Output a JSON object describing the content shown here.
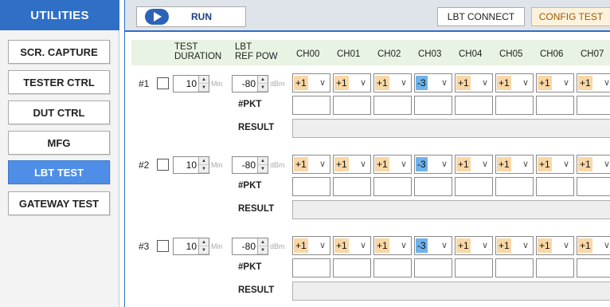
{
  "sidebar": {
    "title": "UTILITIES",
    "items": [
      {
        "label": "SCR. CAPTURE",
        "active": false
      },
      {
        "label": "TESTER CTRL",
        "active": false
      },
      {
        "label": "DUT CTRL",
        "active": false
      },
      {
        "label": "MFG",
        "active": false
      },
      {
        "label": "LBT TEST",
        "active": true
      },
      {
        "label": "GATEWAY TEST",
        "active": false
      }
    ]
  },
  "toolbar": {
    "run_label": "RUN",
    "lbt_connect_label": "LBT CONNECT",
    "config_test_label": "CONFIG TEST"
  },
  "table": {
    "test_duration_header": [
      "TEST",
      "DURATION"
    ],
    "lbt_ref_pow_header": [
      "LBT",
      "REF POW"
    ],
    "channels": [
      "CH00",
      "CH01",
      "CH02",
      "CH03",
      "CH04",
      "CH05",
      "CH06",
      "CH07"
    ],
    "pkt_label": "#PKT",
    "result_label": "RESULT",
    "duration_unit": "Min",
    "power_unit": "dBm"
  },
  "groups": [
    {
      "label": "#1",
      "duration": "10",
      "ref_pow": "-80",
      "channel_values": [
        "+1",
        "+1",
        "+1",
        "-3",
        "+1",
        "+1",
        "+1",
        "+1"
      ]
    },
    {
      "label": "#2",
      "duration": "10",
      "ref_pow": "-80",
      "channel_values": [
        "+1",
        "+1",
        "+1",
        "-3",
        "+1",
        "+1",
        "+1",
        "+1"
      ]
    },
    {
      "label": "#3",
      "duration": "10",
      "ref_pow": "-80",
      "channel_values": [
        "+1",
        "+1",
        "+1",
        "-3",
        "+1",
        "+1",
        "+1",
        "+1"
      ]
    }
  ],
  "colors": {
    "accent": "#2f6fc6",
    "active_item": "#4f8ee6",
    "dropdown_default_bg": "#f9d7a6",
    "dropdown_highlight_bg": "#6fb2ea",
    "header_strip_bg": "#e8f3e3"
  },
  "icons": {
    "run": "play-icon",
    "dropdown": "chevron-down-icon",
    "spinner": "spin-arrows-icon"
  }
}
